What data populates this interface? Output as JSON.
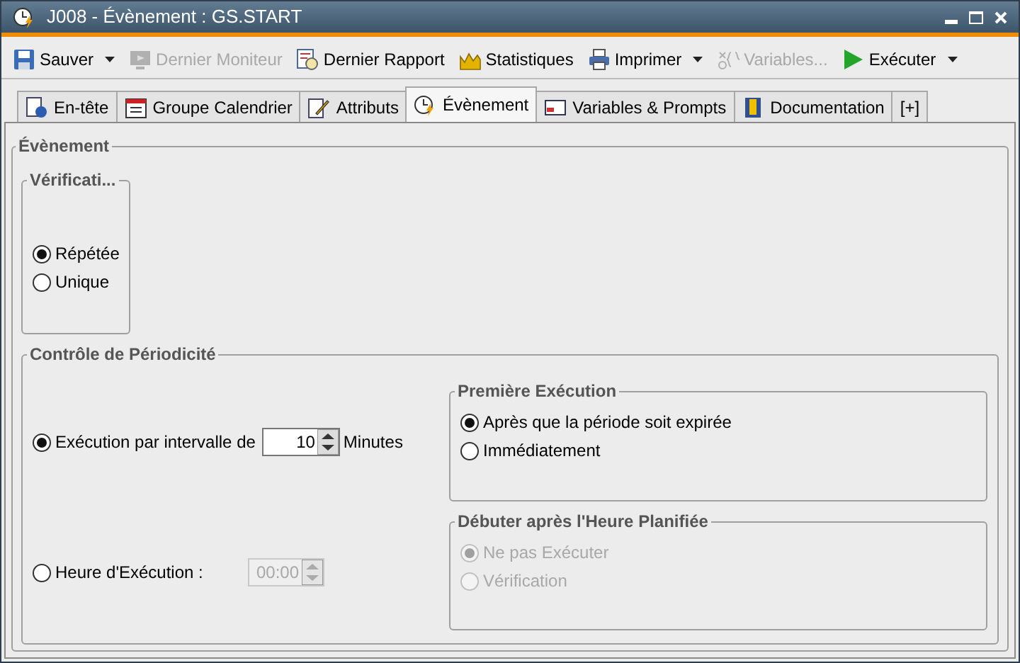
{
  "window": {
    "title": "J008 - Évènement : GS.START"
  },
  "toolbar": [
    {
      "kind": "save",
      "label": "Sauver",
      "disabled": false,
      "dropdown": true
    },
    {
      "kind": "monitor",
      "label": "Dernier Moniteur",
      "disabled": true,
      "dropdown": false
    },
    {
      "kind": "report",
      "label": "Dernier Rapport",
      "disabled": false,
      "dropdown": false
    },
    {
      "kind": "stats",
      "label": "Statistiques",
      "disabled": false,
      "dropdown": false
    },
    {
      "kind": "print",
      "label": "Imprimer",
      "disabled": false,
      "dropdown": true
    },
    {
      "kind": "variables",
      "label": "Variables...",
      "disabled": true,
      "dropdown": false
    },
    {
      "kind": "run",
      "label": "Exécuter",
      "disabled": false,
      "dropdown": true
    }
  ],
  "tabs": [
    {
      "kind": "header",
      "label": "En-tête",
      "selected": false
    },
    {
      "kind": "calendar",
      "label": "Groupe Calendrier",
      "selected": false
    },
    {
      "kind": "attributes",
      "label": "Attributs",
      "selected": false
    },
    {
      "kind": "event",
      "label": "Évènement",
      "selected": true
    },
    {
      "kind": "variables",
      "label": "Variables & Prompts",
      "selected": false
    },
    {
      "kind": "doc",
      "label": "Documentation",
      "selected": false
    },
    {
      "kind": "add",
      "label": "[+]",
      "selected": false
    }
  ],
  "event_group": {
    "title": "Évènement",
    "verification": {
      "title": "Vérificati...",
      "options": [
        {
          "label": "Répétée",
          "selected": true,
          "disabled": false
        },
        {
          "label": "Unique",
          "selected": false,
          "disabled": false
        }
      ]
    },
    "periodicity": {
      "title": "Contrôle de Périodicité",
      "interval": {
        "label": "Exécution par intervalle de",
        "selected": true,
        "value": "10",
        "disabled": false,
        "unit": "Minutes"
      },
      "time": {
        "label": "Heure d'Exécution :",
        "selected": false,
        "value": "00:00",
        "disabled": true
      },
      "first_execution": {
        "title": "Première Exécution",
        "options": [
          {
            "label": "Après que la période soit expirée",
            "selected": true,
            "disabled": false
          },
          {
            "label": "Immédiatement",
            "selected": false,
            "disabled": false
          }
        ]
      },
      "start_after": {
        "title": "Débuter après l'Heure Planifiée",
        "options": [
          {
            "label": "Ne pas Exécuter",
            "selected": true,
            "disabled": true
          },
          {
            "label": "Vérification",
            "selected": false,
            "disabled": true
          }
        ]
      }
    }
  }
}
